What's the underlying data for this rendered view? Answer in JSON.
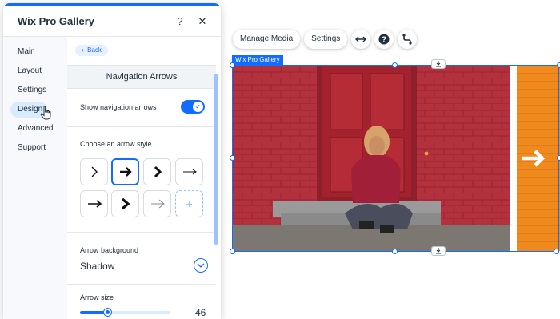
{
  "panel": {
    "title": "Wix Pro Gallery",
    "help_glyph": "?",
    "close_glyph": "✕"
  },
  "sidebar": {
    "items": [
      {
        "label": "Main"
      },
      {
        "label": "Layout"
      },
      {
        "label": "Settings"
      },
      {
        "label": "Design",
        "active": true
      },
      {
        "label": "Advanced"
      },
      {
        "label": "Support"
      }
    ]
  },
  "content": {
    "back_label": "Back",
    "section_title": "Navigation Arrows",
    "show_arrows_label": "Show navigation arrows",
    "show_arrows_on": true,
    "arrow_style_label": "Choose an arrow style",
    "arrow_styles": [
      "thin-chevron",
      "bold-arrow",
      "bold-chevron",
      "thin-long-arrow",
      "medium-arrow",
      "heavy-chevron",
      "light-arrow",
      "add-style"
    ],
    "add_glyph": "+",
    "arrow_background_label": "Arrow background",
    "arrow_background_value": "Shadow",
    "arrow_size_label": "Arrow size",
    "arrow_size_value": "46",
    "arrow_size_fraction": 0.3
  },
  "toolbar": {
    "manage_media": "Manage Media",
    "settings": "Settings",
    "icons": [
      "stretch-icon",
      "help-icon",
      "connect-icon"
    ]
  },
  "gallery": {
    "tag": "Wix Pro Gallery"
  },
  "colors": {
    "accent": "#116dff",
    "brick": "#b2313c",
    "door": "#8f1f2a",
    "orange": "#f08a1c"
  }
}
